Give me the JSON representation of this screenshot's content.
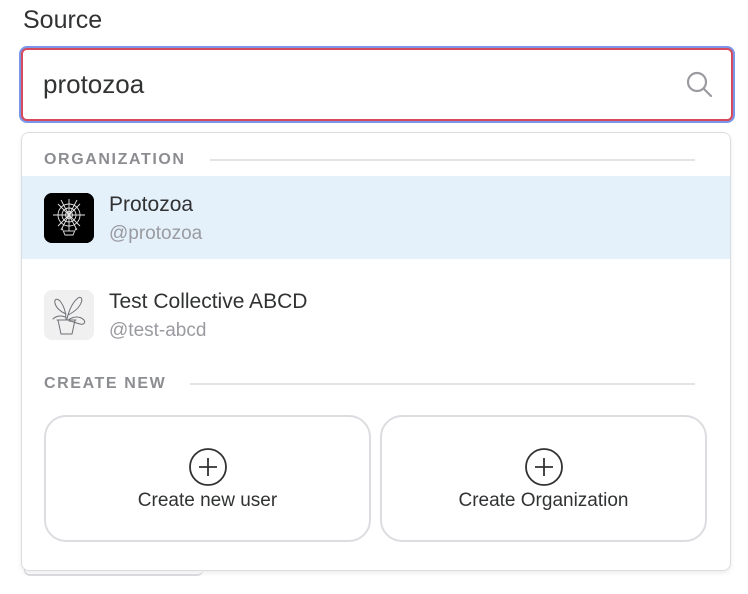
{
  "field": {
    "label": "Source",
    "search_value": "protozoa",
    "search_icon": "search-icon"
  },
  "dropdown": {
    "organization_header": "ORGANIZATION",
    "results": [
      {
        "name": "Protozoa",
        "slug": "@protozoa",
        "selected": true,
        "avatar": "protozoa-logo"
      },
      {
        "name": "Test Collective ABCD",
        "slug": "@test-abcd",
        "selected": false,
        "avatar": "plant-logo"
      }
    ],
    "create_header": "CREATE NEW",
    "create_actions": [
      {
        "label": "Create new user",
        "icon": "plus-circle-icon"
      },
      {
        "label": "Create Organization",
        "icon": "plus-circle-icon"
      }
    ]
  },
  "colors": {
    "selected_row": "#e4f0fa",
    "input_border": "#d74a5b",
    "focus_ring": "#7b95e8"
  }
}
